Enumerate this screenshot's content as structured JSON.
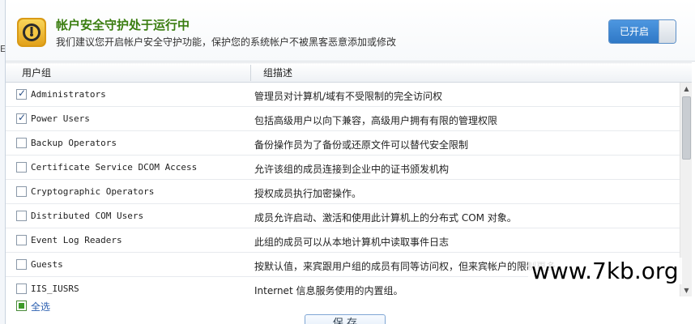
{
  "header": {
    "title": "帐户安全守护处于运行中",
    "subtitle": "我们建议您开启帐户安全守护功能，保护您的系统帐户不被黑客恶意添加或修改",
    "toggle_label": "已开启",
    "icon": "shield-lock-icon"
  },
  "table": {
    "columns": [
      "用户组",
      "组描述"
    ],
    "rows": [
      {
        "name": "Administrators",
        "desc": "管理员对计算机/域有不受限制的完全访问权",
        "checked": true
      },
      {
        "name": "Power Users",
        "desc": "包括高级用户以向下兼容，高级用户拥有有限的管理权限",
        "checked": true
      },
      {
        "name": "Backup Operators",
        "desc": "备份操作员为了备份或还原文件可以替代安全限制",
        "checked": false
      },
      {
        "name": "Certificate Service DCOM Access",
        "desc": "允许该组的成员连接到企业中的证书颁发机构",
        "checked": false
      },
      {
        "name": "Cryptographic Operators",
        "desc": "授权成员执行加密操作。",
        "checked": false
      },
      {
        "name": "Distributed COM Users",
        "desc": "成员允许启动、激活和使用此计算机上的分布式 COM 对象。",
        "checked": false
      },
      {
        "name": "Event Log Readers",
        "desc": "此组的成员可以从本地计算机中读取事件日志",
        "checked": false
      },
      {
        "name": "Guests",
        "desc": "按默认值，来宾跟用户组的成员有同等访问权，但来宾帐户的限制更多",
        "checked": false
      },
      {
        "name": "IIS_IUSRS",
        "desc": "Internet 信息服务使用的内置组。",
        "checked": false
      }
    ]
  },
  "footer": {
    "select_all_label": "全选",
    "button_label": "保 存"
  },
  "watermark": "www.7kb.org",
  "colors": {
    "title": "#3a7d10",
    "toggle_on": "#2f78c6",
    "select_all": "#3d9a28"
  }
}
